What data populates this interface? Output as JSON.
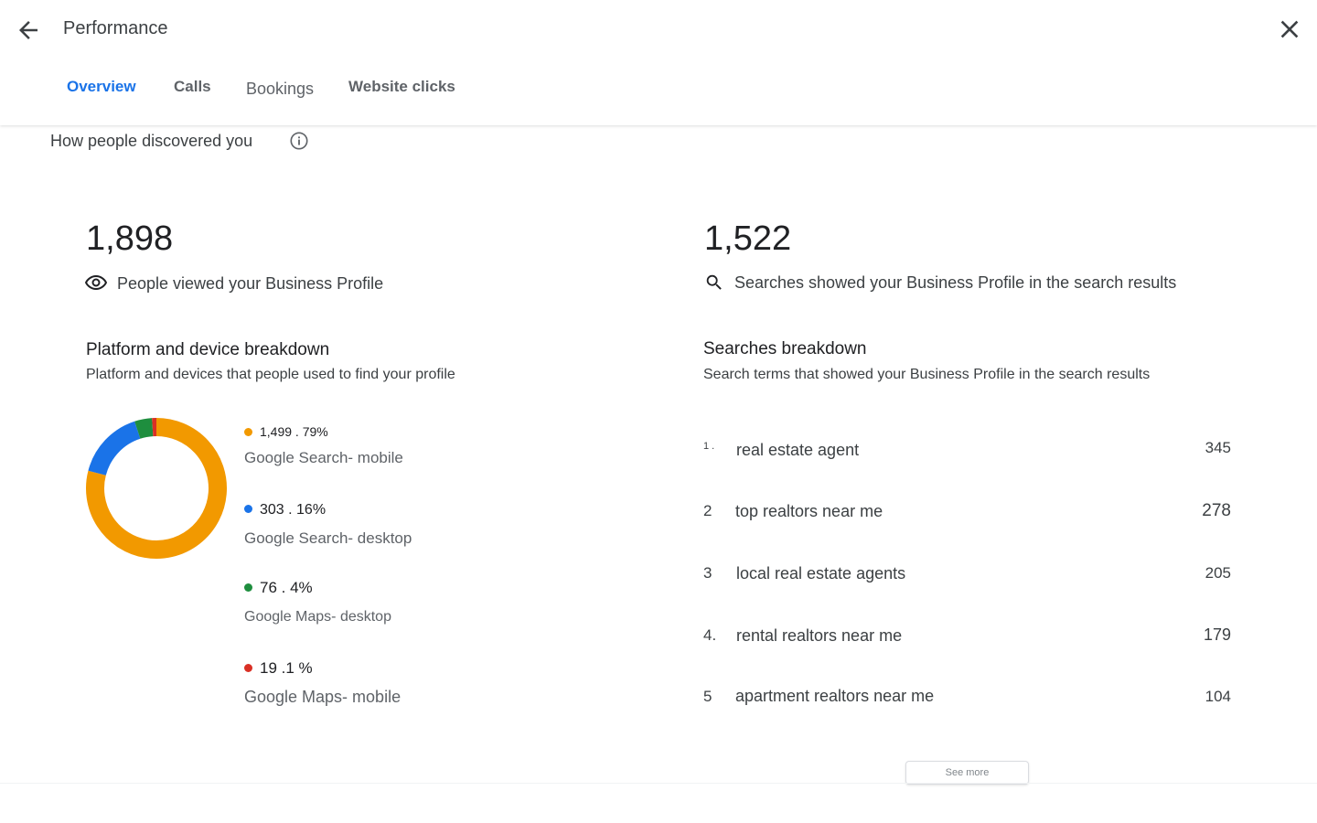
{
  "header": {
    "title": "Performance",
    "tabs": [
      {
        "label": "Overview"
      },
      {
        "label": "Calls"
      },
      {
        "label": "Bookings"
      },
      {
        "label": "Website clicks"
      }
    ]
  },
  "discovery": {
    "title": "How people discovered you",
    "views": {
      "value": "1,898",
      "label": "People viewed your Business Profile"
    },
    "searches": {
      "value": "1,522",
      "label": "Searches showed your Business Profile in the search results"
    }
  },
  "platform": {
    "title": "Platform and device breakdown",
    "description": "Platform and devices that people used to find your profile",
    "items": [
      {
        "value": "1,499 . 79%",
        "label": "Google Search- mobile",
        "count": 1499,
        "color": "#f29900"
      },
      {
        "value": "303 . 16%",
        "label": "Google Search- desktop",
        "count": 303,
        "color": "#1a73e8"
      },
      {
        "value": "76 . 4%",
        "label": "Google Maps- desktop",
        "count": 76,
        "color": "#1e8e3e"
      },
      {
        "value": "19 .1 %",
        "label": "Google Maps- mobile",
        "count": 19,
        "color": "#d93025"
      }
    ]
  },
  "searches_breakdown": {
    "title": "Searches breakdown",
    "description": "Search terms that showed your Business Profile in the search results",
    "rows": [
      {
        "rank": "1 .",
        "term": "real estate agent",
        "count": "345"
      },
      {
        "rank": "2",
        "term": "top realtors near me",
        "count": "278"
      },
      {
        "rank": "3",
        "term": "local real estate agents",
        "count": "205"
      },
      {
        "rank": "4.",
        "term": "rental realtors near me",
        "count": "179"
      },
      {
        "rank": "5",
        "term": "apartment realtors near me",
        "count": "104"
      }
    ],
    "see_more": "See more"
  }
}
